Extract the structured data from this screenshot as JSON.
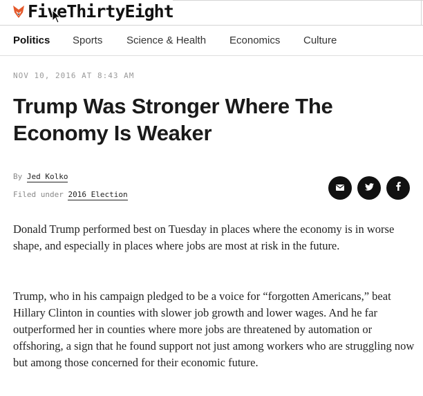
{
  "header": {
    "logo_text": "FiveThirtyEight",
    "logo_icon": "fox-icon"
  },
  "nav": {
    "items": [
      {
        "label": "Politics",
        "active": true
      },
      {
        "label": "Sports",
        "active": false
      },
      {
        "label": "Science & Health",
        "active": false
      },
      {
        "label": "Economics",
        "active": false
      },
      {
        "label": "Culture",
        "active": false
      }
    ]
  },
  "article": {
    "dateline": "NOV 10, 2016 AT 8:43 AM",
    "headline": "Trump Was Stronger Where The Economy Is Weaker",
    "byline_prefix": "By",
    "author": "Jed Kolko",
    "filed_prefix": "Filed under",
    "filed_under": "2016 Election",
    "paragraphs": [
      "Donald Trump performed best on Tuesday in places where the economy is in worse shape, and especially in places where jobs are most at risk in the future.",
      "Trump, who in his campaign pledged to be a voice for “forgotten Americans,” beat Hillary Clinton in counties with slower job growth and lower wages. And he far outperformed her in counties where more jobs are threatened by automation or offshoring, a sign that he found support not just among workers who are struggling now but among those concerned for their economic future."
    ]
  },
  "share": {
    "email_icon": "email-icon",
    "twitter_icon": "twitter-icon",
    "facebook_icon": "facebook-icon"
  },
  "colors": {
    "logo_accent": "#e5592b",
    "share_bg": "#111111",
    "text": "#222222",
    "meta": "#888888"
  }
}
